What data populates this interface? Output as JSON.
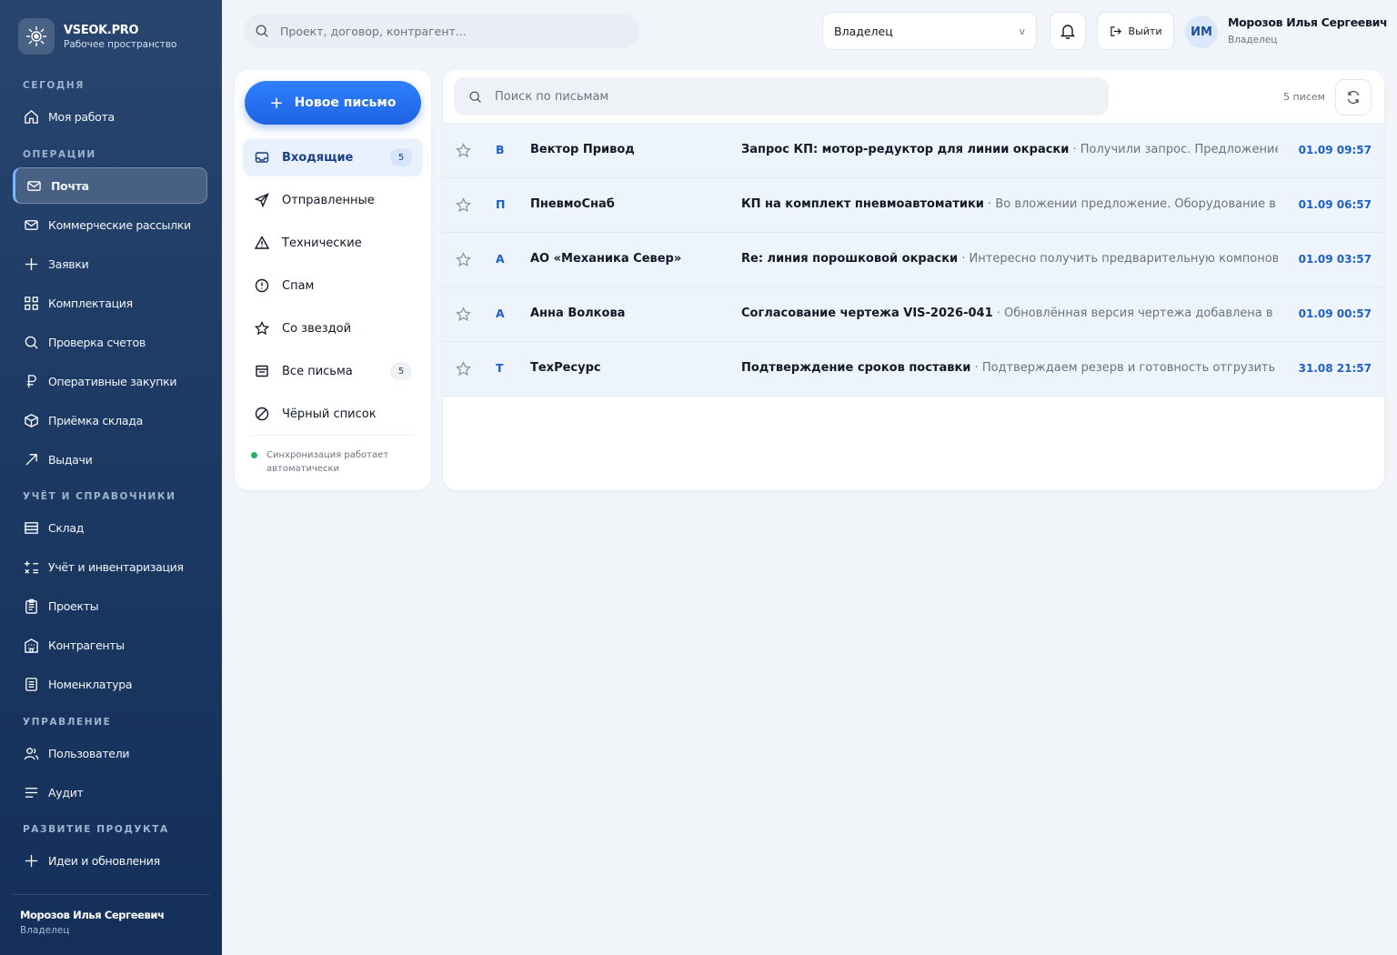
{
  "brand": {
    "name": "VSEOK.PRO",
    "subtitle": "Рабочее пространство"
  },
  "sidebar": {
    "sections": [
      {
        "title": "СЕГОДНЯ"
      },
      {
        "title": "ОПЕРАЦИИ"
      },
      {
        "title": "УЧЁТ И СПРАВОЧНИКИ"
      },
      {
        "title": "УПРАВЛЕНИЕ"
      },
      {
        "title": "РАЗВИТИЕ ПРОДУКТА"
      }
    ],
    "items": [
      {
        "label": "Моя работа",
        "icon": "home-icon"
      },
      {
        "label": "Почта",
        "icon": "mail-icon",
        "active": true
      },
      {
        "label": "Коммерческие рассылки",
        "icon": "mail-icon"
      },
      {
        "label": "Заявки",
        "icon": "plus-icon"
      },
      {
        "label": "Комплектация",
        "icon": "grid-icon"
      },
      {
        "label": "Проверка счетов",
        "icon": "search-icon"
      },
      {
        "label": "Оперативные закупки",
        "icon": "ruble-icon"
      },
      {
        "label": "Приёмка склада",
        "icon": "box-icon"
      },
      {
        "label": "Выдачи",
        "icon": "arrow-up-right-icon"
      },
      {
        "label": "Склад",
        "icon": "warehouse-icon"
      },
      {
        "label": "Учёт и инвентаризация",
        "icon": "calculator-icon"
      },
      {
        "label": "Проекты",
        "icon": "clipboard-icon"
      },
      {
        "label": "Контрагенты",
        "icon": "building-icon"
      },
      {
        "label": "Номенклатура",
        "icon": "list-icon"
      },
      {
        "label": "Пользователи",
        "icon": "users-icon"
      },
      {
        "label": "Аудит",
        "icon": "lines-icon"
      },
      {
        "label": "Идеи и обновления",
        "icon": "plus-icon"
      }
    ],
    "footer": {
      "name": "Морозов Илья Сергеевич",
      "role": "Владелец"
    }
  },
  "header": {
    "search_placeholder": "Проект, договор, контрагент...",
    "role_select": "Владелец",
    "logout_label": "Выйти",
    "avatar_initials": "ИМ",
    "user_name": "Морозов Илья Сергеевич",
    "user_role": "Владелец"
  },
  "folders": {
    "compose_label": "Новое письмо",
    "items": [
      {
        "label": "Входящие",
        "count": "5",
        "icon": "inbox-icon",
        "active": true
      },
      {
        "label": "Отправленные",
        "icon": "send-icon"
      },
      {
        "label": "Технические",
        "icon": "warning-icon"
      },
      {
        "label": "Спам",
        "icon": "alert-circle-icon"
      },
      {
        "label": "Со звездой",
        "icon": "star-icon"
      },
      {
        "label": "Все письма",
        "count": "5",
        "icon": "archive-icon"
      },
      {
        "label": "Чёрный список",
        "icon": "block-icon"
      }
    ],
    "sync_text": "Синхронизация работает автоматически"
  },
  "mail": {
    "search_placeholder": "Поиск по письмам",
    "count_label": "5 писем",
    "rows": [
      {
        "letter": "В",
        "sender": "Вектор Привод",
        "subject": "Запрос КП: мотор-редуктор для линии окраски",
        "preview": "Получили запрос. Предложение и ср...",
        "time": "01.09 09:57"
      },
      {
        "letter": "П",
        "sender": "ПневмоСнаб",
        "subject": "КП на комплект пневмоавтоматики",
        "preview": "Во вложении предложение. Оборудование в нал...",
        "time": "01.09 06:57"
      },
      {
        "letter": "А",
        "sender": "АО «Механика Север»",
        "subject": "Re: линия порошковой окраски",
        "preview": "Интересно получить предварительную компоновку и...",
        "time": "01.09 03:57"
      },
      {
        "letter": "А",
        "sender": "Анна Волкова",
        "subject": "Согласование чертежа VIS-2026-041",
        "preview": "Обновлённая версия чертежа добавлена в прое...",
        "time": "01.09 00:57"
      },
      {
        "letter": "Т",
        "sender": "ТехРесурс",
        "subject": "Подтверждение сроков поставки",
        "preview": "Подтверждаем резерв и готовность отгрузить заказ...",
        "time": "31.08 21:57"
      }
    ]
  },
  "colors": {
    "accent": "#1e63e3",
    "sidebar": "#1c3a63",
    "sync_ok": "#1fb36b"
  }
}
